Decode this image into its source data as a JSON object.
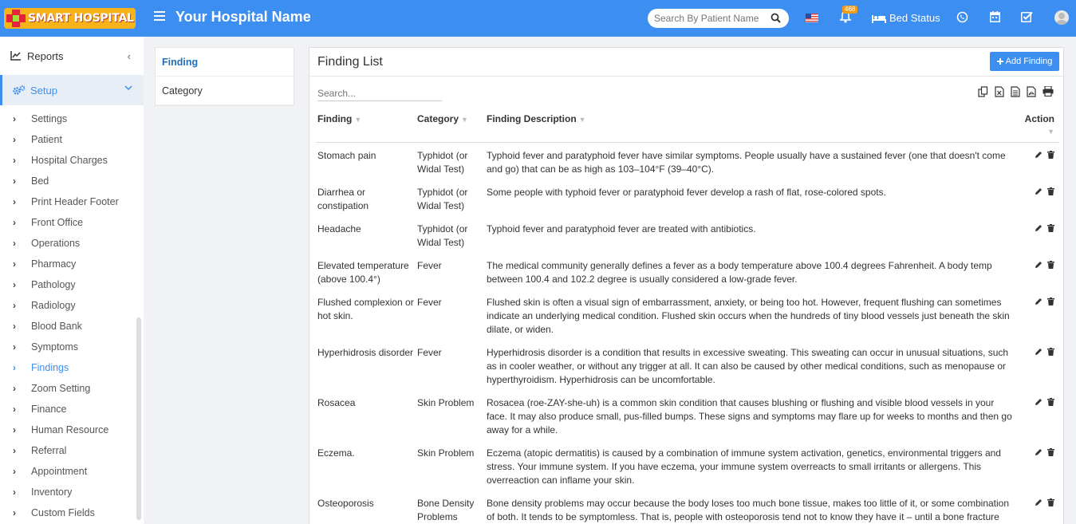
{
  "header": {
    "logo_text": "SMART HOSPITAL",
    "hospital_name": "Your Hospital Name",
    "search_placeholder": "Search By Patient Name",
    "notification_count": "468",
    "bed_status_label": "Bed Status"
  },
  "sidebar": {
    "reports_label": "Reports",
    "setup_label": "Setup",
    "items": [
      {
        "label": "Settings"
      },
      {
        "label": "Patient"
      },
      {
        "label": "Hospital Charges"
      },
      {
        "label": "Bed"
      },
      {
        "label": "Print Header Footer"
      },
      {
        "label": "Front Office"
      },
      {
        "label": "Operations"
      },
      {
        "label": "Pharmacy"
      },
      {
        "label": "Pathology"
      },
      {
        "label": "Radiology"
      },
      {
        "label": "Blood Bank"
      },
      {
        "label": "Symptoms"
      },
      {
        "label": "Findings"
      },
      {
        "label": "Zoom Setting"
      },
      {
        "label": "Finance"
      },
      {
        "label": "Human Resource"
      },
      {
        "label": "Referral"
      },
      {
        "label": "Appointment"
      },
      {
        "label": "Inventory"
      },
      {
        "label": "Custom Fields"
      }
    ],
    "active_index": 12
  },
  "subpanel": {
    "items": [
      "Finding",
      "Category"
    ]
  },
  "main": {
    "title": "Finding List",
    "add_button": "Add Finding",
    "search_placeholder": "Search...",
    "columns": [
      "Finding",
      "Category",
      "Finding Description",
      "Action"
    ],
    "rows": [
      {
        "finding": "Stomach pain",
        "category": "Typhidot (or Widal Test)",
        "description": "Typhoid fever and paratyphoid fever have similar symptoms. People usually have a sustained fever (one that doesn't come and go) that can be as high as 103–104°F (39–40°C)."
      },
      {
        "finding": "Diarrhea or constipation",
        "category": "Typhidot (or Widal Test)",
        "description": "Some people with typhoid fever or paratyphoid fever develop a rash of flat, rose-colored spots."
      },
      {
        "finding": "Headache",
        "category": "Typhidot (or Widal Test)",
        "description": "Typhoid fever and paratyphoid fever are treated with antibiotics."
      },
      {
        "finding": "Elevated temperature (above 100.4°)",
        "category": "Fever",
        "description": "The medical community generally defines a fever as a body temperature above 100.4 degrees Fahrenheit. A body temp between 100.4 and 102.2 degree is usually considered a low-grade fever."
      },
      {
        "finding": "Flushed complexion or hot skin.",
        "category": "Fever",
        "description": "Flushed skin is often a visual sign of embarrassment, anxiety, or being too hot. However, frequent flushing can sometimes indicate an underlying medical condition. Flushed skin occurs when the hundreds of tiny blood vessels just beneath the skin dilate, or widen."
      },
      {
        "finding": "Hyperhidrosis disorder",
        "category": "Fever",
        "description": "Hyperhidrosis disorder is a condition that results in excessive sweating. This sweating can occur in unusual situations, such as in cooler weather, or without any trigger at all. It can also be caused by other medical conditions, such as menopause or hyperthyroidism. Hyperhidrosis can be uncomfortable."
      },
      {
        "finding": "Rosacea",
        "category": "Skin Problem",
        "description": "Rosacea (roe-ZAY-she-uh) is a common skin condition that causes blushing or flushing and visible blood vessels in your face. It may also produce small, pus-filled bumps. These signs and symptoms may flare up for weeks to months and then go away for a while."
      },
      {
        "finding": "Eczema.",
        "category": "Skin Problem",
        "description": "Eczema (atopic dermatitis) is caused by a combination of immune system activation, genetics, environmental triggers and stress. Your immune system. If you have eczema, your immune system overreacts to small irritants or allergens. This overreaction can inflame your skin."
      },
      {
        "finding": "Osteoporosis",
        "category": "Bone Density Problems",
        "description": "Bone density problems may occur because the body loses too much bone tissue, makes too little of it, or some combination of both. It tends to be symptomless. That is, people with osteoporosis tend not to know they have it – until a bone fracture has them visiting a doctor who makes the diagnosis."
      }
    ]
  }
}
